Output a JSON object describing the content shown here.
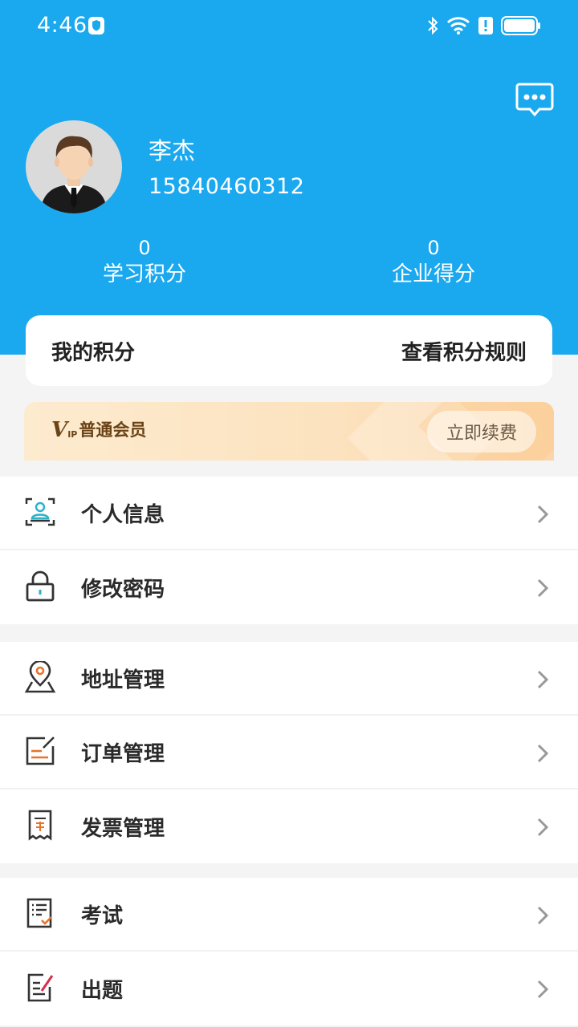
{
  "status_bar": {
    "time": "4:46"
  },
  "header": {
    "user_name": "李杰",
    "phone": "15840460312",
    "stats": [
      {
        "value": "0",
        "label": "学习积分"
      },
      {
        "value": "0",
        "label": "企业得分"
      }
    ]
  },
  "points_card": {
    "title": "我的积分",
    "action": "查看积分规则"
  },
  "vip": {
    "logo_v": "V",
    "logo_ip": "IP",
    "level": "普通会员",
    "renew": "立即续费"
  },
  "menu": {
    "group1": [
      {
        "label": "个人信息",
        "icon": "person-card-icon"
      },
      {
        "label": "修改密码",
        "icon": "lock-icon"
      }
    ],
    "group2": [
      {
        "label": "地址管理",
        "icon": "location-pin-icon"
      },
      {
        "label": "订单管理",
        "icon": "order-edit-icon"
      },
      {
        "label": "发票管理",
        "icon": "invoice-icon"
      }
    ],
    "group3": [
      {
        "label": "考试",
        "icon": "exam-checklist-icon"
      },
      {
        "label": "出题",
        "icon": "write-question-icon"
      }
    ]
  },
  "colors": {
    "header_blue": "#1aa8ef",
    "accent_orange": "#e8742a",
    "accent_teal": "#2bb3c8"
  }
}
